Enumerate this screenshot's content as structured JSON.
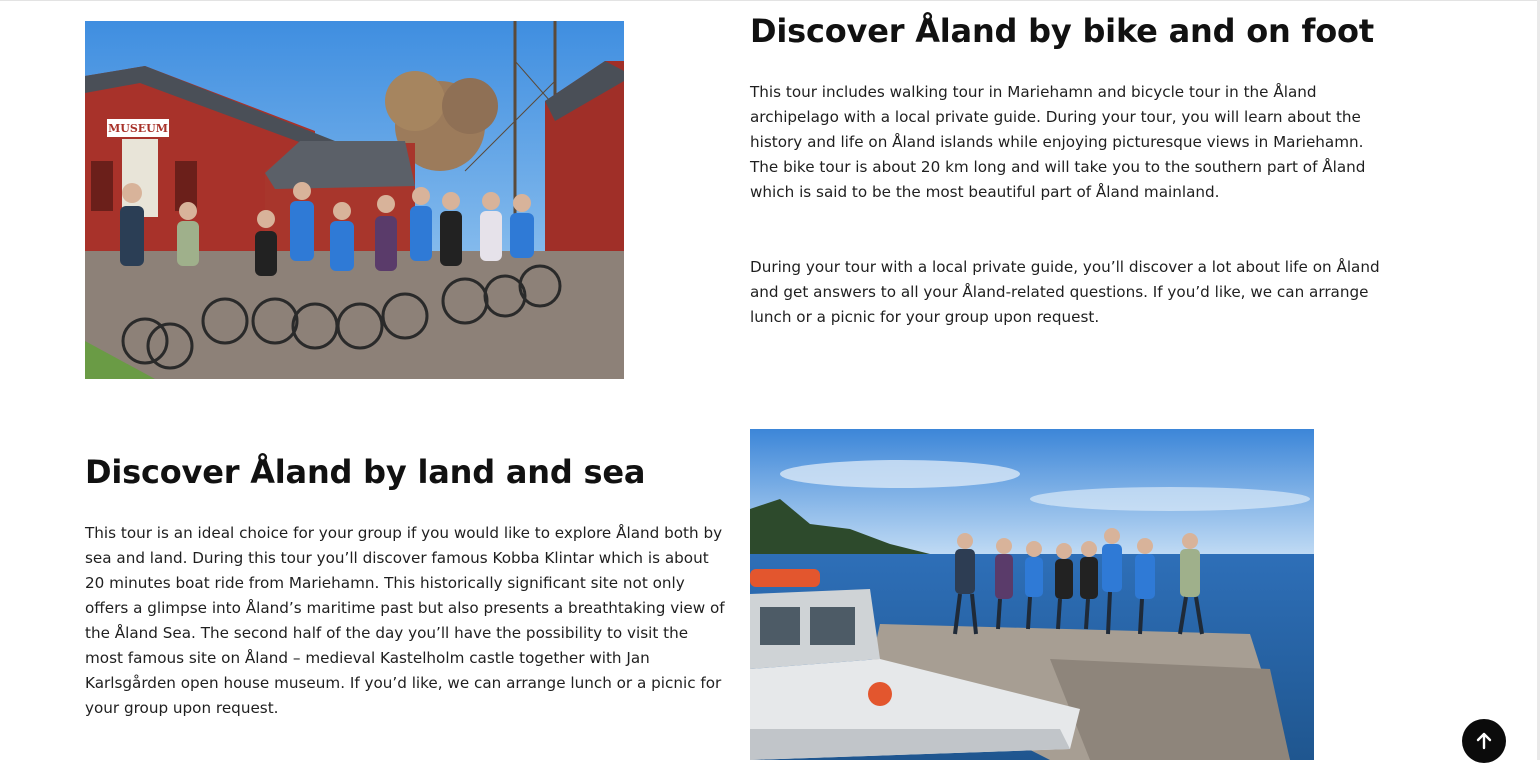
{
  "section_bike": {
    "title": "Discover Åland by bike and on foot",
    "paragraph_1": "This tour includes walking tour in Mariehamn and bicycle tour in the Åland archipelago with a local private guide. During your tour, you will learn about the history and life on Åland islands while enjoying picturesque views in Mariehamn. The bike tour is about 20 km long and will take you to the southern part of Åland which is said to be the most beautiful part of Åland mainland.",
    "paragraph_2": "During your tour with a local private guide, you’ll discover a lot about life on Åland and get answers to all your Åland-related questions. If you’d like, we can arrange lunch or a picnic for your group upon request.",
    "photo_sign": "MUSEUM"
  },
  "section_sea": {
    "title": "Discover Åland by land and sea",
    "paragraph_1": "This tour is an ideal choice for your group if you would like to explore Åland both by sea and land. During this tour you’ll discover famous Kobba Klintar which is about 20 minutes boat ride from Mariehamn. This historically significant site not only offers a glimpse into Åland’s maritime past but also presents a breathtaking view of the Åland Sea. The second half of the day you’ll have the possibility to visit the most famous site on Åland – medieval Kastelholm castle together with Jan Karlsgården open house museum. If you’d like, we can arrange lunch or a picnic for your group upon request."
  },
  "back_to_top": {
    "icon": "arrow-up-icon"
  },
  "colors": {
    "text": "#1f1f1f",
    "heading": "#111111",
    "button": "#0b0b0b"
  }
}
